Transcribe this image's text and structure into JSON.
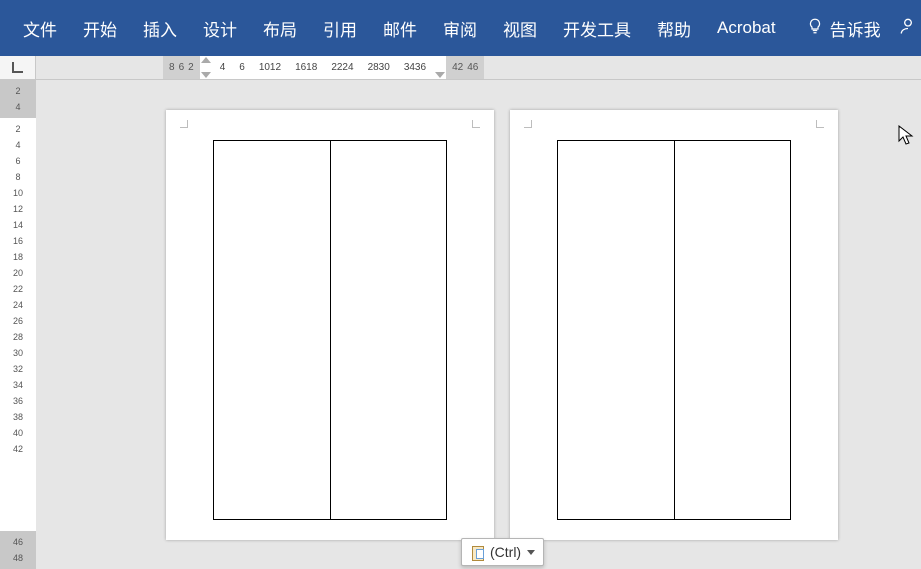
{
  "ribbon": {
    "tabs": [
      {
        "label": "文件"
      },
      {
        "label": "开始"
      },
      {
        "label": "插入"
      },
      {
        "label": "设计"
      },
      {
        "label": "布局"
      },
      {
        "label": "引用"
      },
      {
        "label": "邮件"
      },
      {
        "label": "审阅"
      },
      {
        "label": "视图"
      },
      {
        "label": "开发工具"
      },
      {
        "label": "帮助"
      },
      {
        "label": "Acrobat"
      }
    ],
    "tellme": "告诉我"
  },
  "hruler": {
    "left_margin": [
      "8",
      "6",
      "2"
    ],
    "body": [
      "4",
      "6",
      "1012",
      "1618",
      "2224",
      "2830",
      "3436"
    ],
    "right_margin": [
      "42",
      "46"
    ]
  },
  "vruler": {
    "top_margin": [
      "2",
      "4"
    ],
    "body": [
      "2",
      "4",
      "6",
      "8",
      "10",
      "12",
      "14",
      "16",
      "18",
      "20",
      "22",
      "24",
      "26",
      "28",
      "30",
      "32",
      "34",
      "36",
      "38",
      "40",
      "42"
    ],
    "bottom_margin": [
      "46",
      "48"
    ]
  },
  "paste": {
    "label": "(Ctrl)"
  }
}
